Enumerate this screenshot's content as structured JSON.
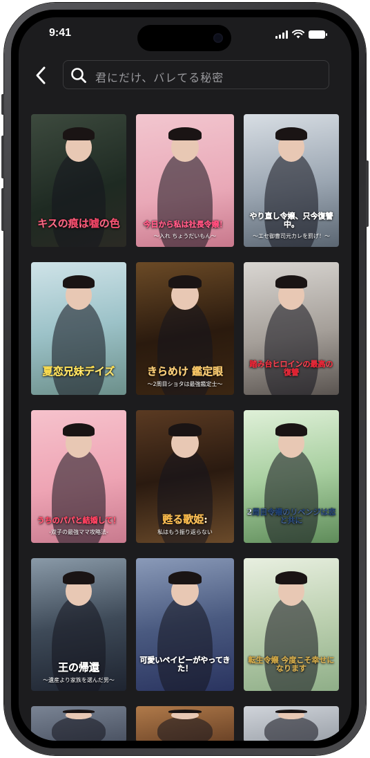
{
  "status_bar": {
    "time": "9:41"
  },
  "search": {
    "text": "君にだけ、バレてる秘密"
  },
  "cards": [
    {
      "title": "キスの痕は嘘の色",
      "subtitle": "",
      "bg": "linear-gradient(160deg,#3d4a3e,#1e2a22 60%,#2b2a24)",
      "accent": "#e23a5a"
    },
    {
      "title": "今日から私は社長令嬢！",
      "subtitle": "～入れ ちょうだいもん～",
      "bg": "linear-gradient(170deg,#f2c6cf,#e9a8b7 60%,#c8788c)",
      "accent": "#ff4a7a"
    },
    {
      "title": "やり直し令嬢、只今復讐中。",
      "subtitle": "～エセ御曹司元カレを罰げ！～",
      "bg": "linear-gradient(170deg,#d8dee4,#9aa5b1 55%,#5b6672)",
      "accent": "#ffffff"
    },
    {
      "title": "夏恋兄妹デイズ",
      "subtitle": "",
      "bg": "linear-gradient(170deg,#cfe3e8,#9cc2c8 50%,#6c8f8a)",
      "accent": "#f6d84a"
    },
    {
      "title": "きらめけ 鑑定眼",
      "subtitle": "～2周目ショタは最強鑑定士～",
      "bg": "linear-gradient(170deg,#6b4a26,#2a1a0e 55%,#3b2612)",
      "accent": "#f2c060"
    },
    {
      "title": "踏み台ヒロインの最高の復讐",
      "subtitle": "",
      "bg": "linear-gradient(170deg,#d9d6d2,#a59f99 55%,#5a5450)",
      "accent": "#e02030"
    },
    {
      "title": "うちのパパと結婚して！",
      "subtitle": "-双子の最強ママ攻略法-",
      "bg": "linear-gradient(170deg,#f6c2cc,#eea4b4 55%,#c87a8e)",
      "accent": "#ff3a5a"
    },
    {
      "title": "甦る歌姫:",
      "subtitle": "私はもう振り返らない",
      "bg": "linear-gradient(170deg,#5a3a22,#2a1a10 50%,#6a4a2a)",
      "accent": "#f0b040"
    },
    {
      "title": "2周目令嬢のリベンジは恋と共に",
      "subtitle": "",
      "bg": "linear-gradient(170deg,#dff0d8,#a8cfa0 50%,#5f8c5a)",
      "accent": "#1a3a6a"
    },
    {
      "title": "王の帰還",
      "subtitle": "～遺産より家族を選んだ男～",
      "bg": "linear-gradient(170deg,#8a9aa8,#3e4a58 50%,#1e2430)",
      "accent": "#ffffff"
    },
    {
      "title": "可愛いベイビーがやってきた！",
      "subtitle": "",
      "bg": "linear-gradient(170deg,#8a9ab8,#4a5a80 50%,#2a3460)",
      "accent": "#ffffff"
    },
    {
      "title": "転生令嬢 今度こそ幸せになります",
      "subtitle": "",
      "bg": "linear-gradient(170deg,#e8efe0,#bcd0b0 50%,#8fae88)",
      "accent": "#c8a040"
    },
    {
      "title": "",
      "subtitle": "",
      "bg": "linear-gradient(170deg,#7a8494,#4a5262)",
      "accent": "#ffffff"
    },
    {
      "title": "",
      "subtitle": "",
      "bg": "linear-gradient(170deg,#b07a4a,#6a4226)",
      "accent": "#ffffff"
    },
    {
      "title": "",
      "subtitle": "",
      "bg": "linear-gradient(170deg,#d0d4da,#9aa0a8)",
      "accent": "#ffffff"
    }
  ]
}
